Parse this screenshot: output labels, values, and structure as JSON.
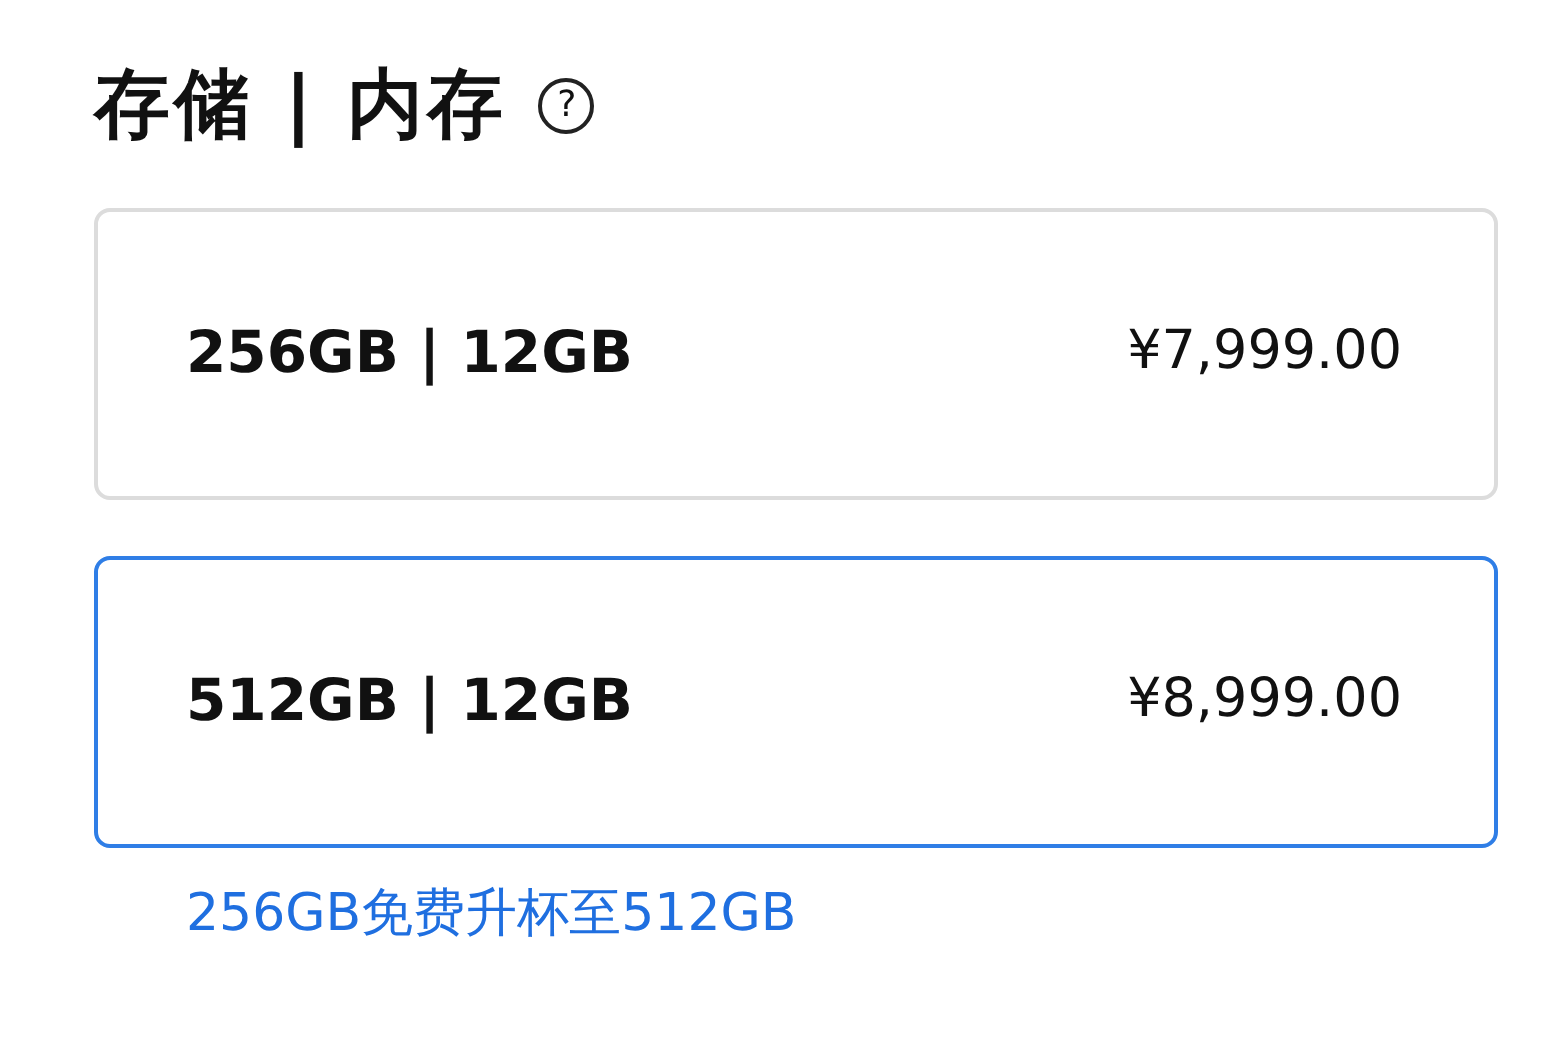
{
  "heading": "存储 | 内存",
  "help": "?",
  "options": [
    {
      "capacity": "256GB | 12GB",
      "price": "¥7,999.00",
      "selected": false
    },
    {
      "capacity": "512GB | 12GB",
      "price": "¥8,999.00",
      "selected": true
    }
  ],
  "promo": "256GB免费升杯至512GB"
}
